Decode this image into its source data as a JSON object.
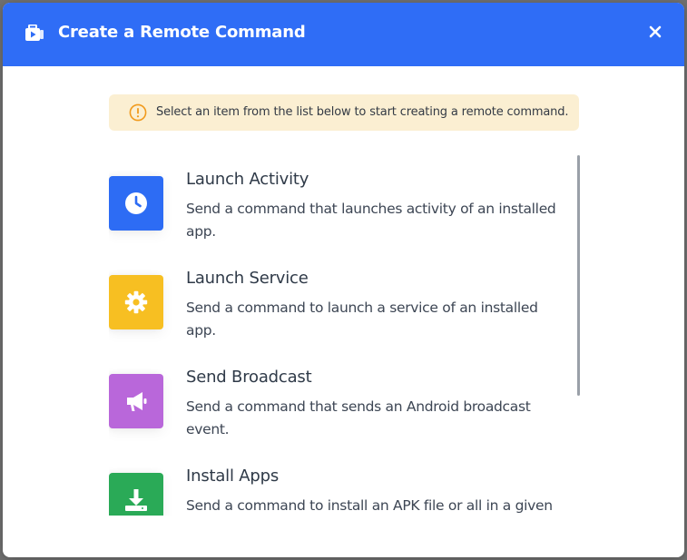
{
  "dialog": {
    "title": "Create a Remote Command",
    "header_icon": "briefcase-play-icon",
    "close_icon": "close-icon",
    "accent_color": "#2f6df6"
  },
  "info": {
    "icon": "info-circle-icon",
    "text": "Select an item from the list below to start creating a remote command.",
    "background": "#fbefd2"
  },
  "items": [
    {
      "title": "Launch Activity",
      "description": "Send a command that launches activity of an installed app.",
      "icon": "clock-icon",
      "color": "#2d6cf4"
    },
    {
      "title": "Launch Service",
      "description": "Send a command to launch a service of an installed app.",
      "icon": "gear-icon",
      "color": "#f7bf22"
    },
    {
      "title": "Send Broadcast",
      "description": "Send a command that sends an Android broadcast event.",
      "icon": "megaphone-icon",
      "color": "#b967da"
    },
    {
      "title": "Install Apps",
      "description": "Send a command to install an APK file or all in a given",
      "icon": "download-icon",
      "color": "#2aaa57"
    }
  ]
}
